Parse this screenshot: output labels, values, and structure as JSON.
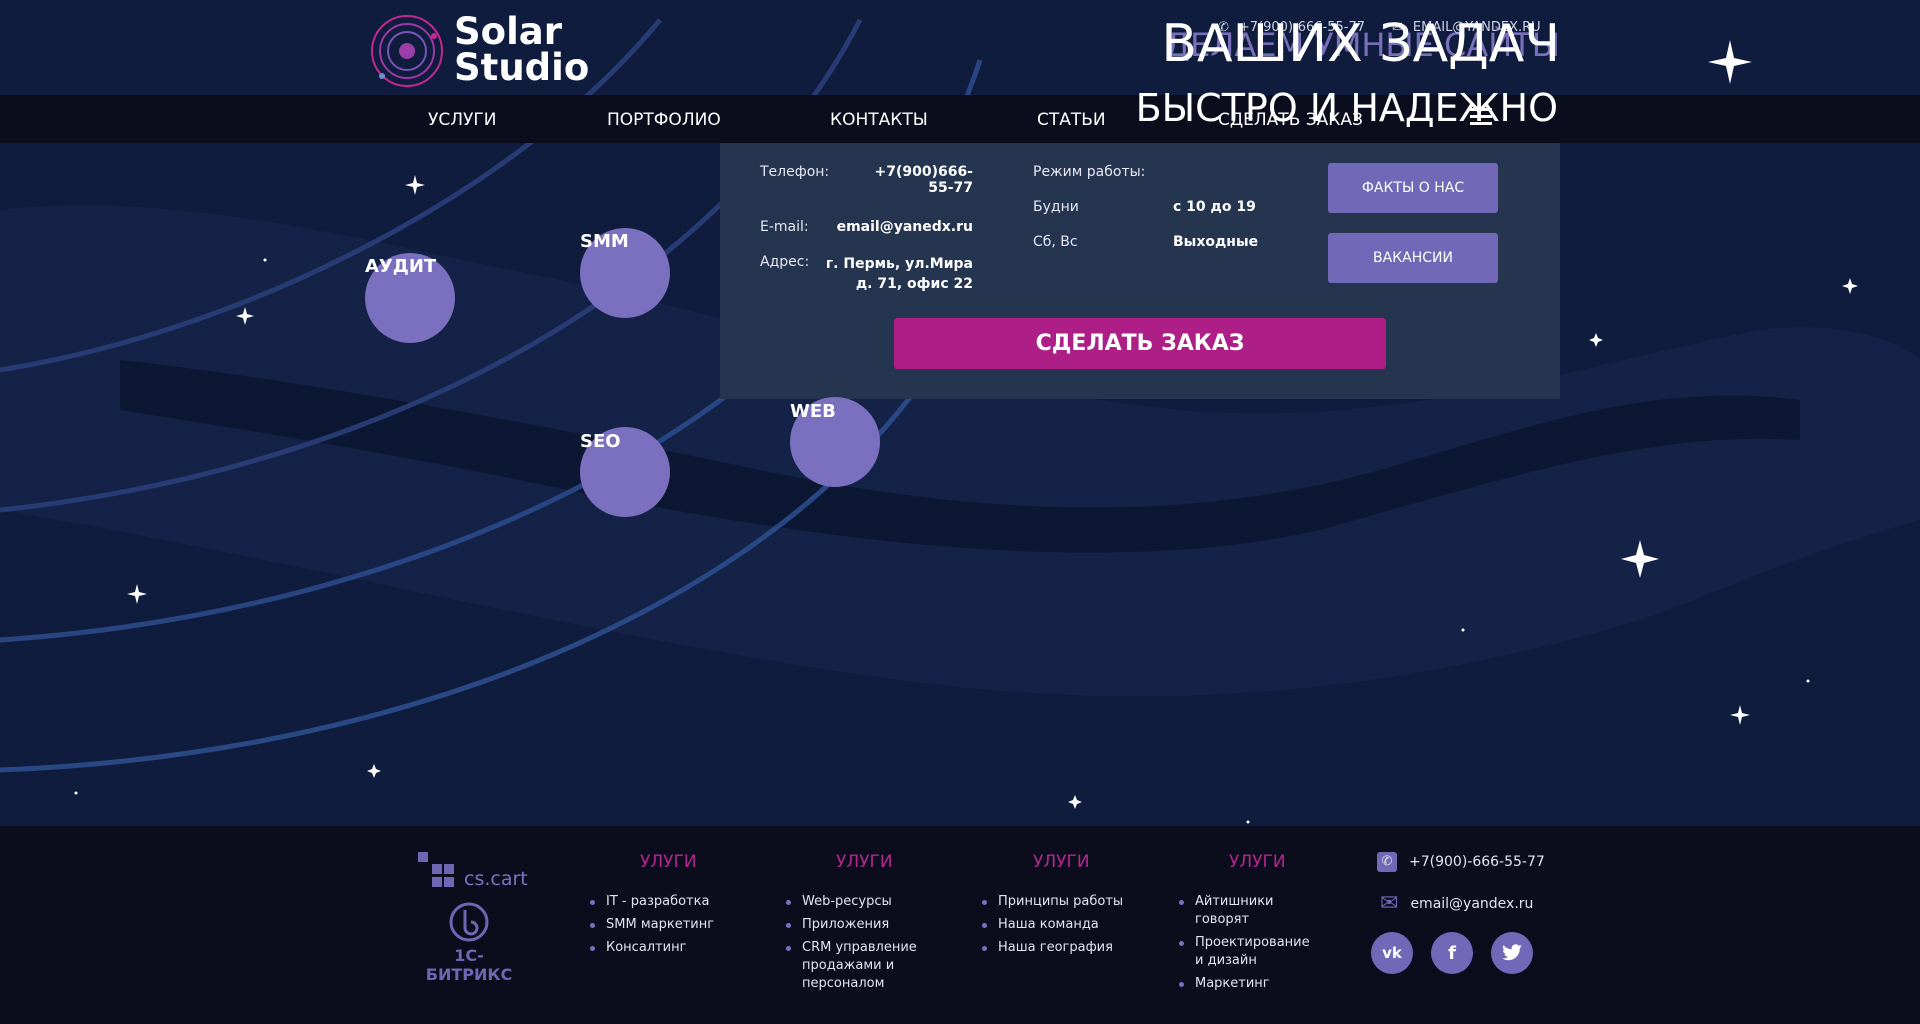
{
  "brand": {
    "name_line1": "Solar",
    "name_line2": "Studio"
  },
  "header": {
    "phone": "+7(900)-666-55-77",
    "email": "EMAIL@YANDEX.RU",
    "hero_title": "ВАШИХ ЗАДАЧ",
    "hero_title_ghost": "ДЕЛАЕМ УМНЫЕ САЙТЫ",
    "hero_subtitle": "БЫСТРО И НАДЕЖНО"
  },
  "nav": {
    "items": [
      "УСЛУГИ",
      "ПОРТФОЛИО",
      "КОНТАКТЫ",
      "СТАТЬИ",
      "СДЕЛАТЬ ЗАКАЗ"
    ]
  },
  "panel": {
    "phone_label": "Телефон:",
    "phone_value": "+7(900)666-55-77",
    "email_label": "E-mail:",
    "email_value": "email@yanedx.ru",
    "address_label": "Адрес:",
    "address_value": "г. Пермь, ул.Мира д. 71, офис 22",
    "hours_label": "Режим работы:",
    "weekdays_label": "Будни",
    "weekdays_value": "с 10 до 19",
    "weekend_label": "Сб, Вс",
    "weekend_value": "Выходные",
    "facts_button": "ФАКТЫ О НАС",
    "vacancies_button": "ВАКАНСИИ",
    "order_button": "СДЕЛАТЬ ЗАКАЗ"
  },
  "planets": {
    "audit": "АУДИТ",
    "smm": "SMM",
    "seo": "SEO",
    "web": "WEB"
  },
  "footer": {
    "logos": {
      "cscart": "cs.cart",
      "bitrix": "1С-БИТРИКС"
    },
    "columns": [
      {
        "title": "УЛУГИ",
        "items": [
          "IT - разработка",
          "SMM маркетинг",
          "Консалтинг"
        ]
      },
      {
        "title": "УЛУГИ",
        "items": [
          "Web-ресурсы",
          "Приложения",
          "CRM управление продажами и персоналом"
        ]
      },
      {
        "title": "УЛУГИ",
        "items": [
          "Принципы работы",
          "Наша команда",
          "Наша география"
        ]
      },
      {
        "title": "УЛУГИ",
        "items": [
          "Айтишники говорят",
          "Проектирование и дизайн",
          "Маркетинг"
        ]
      }
    ],
    "phone": "+7(900)-666-55-77",
    "email": "email@yandex.ru",
    "social": {
      "vk": "vk",
      "facebook": "f",
      "twitter": "twitter"
    }
  },
  "colors": {
    "accent": "#7169b8",
    "order": "#ad1f86",
    "panel": "#253550",
    "nav": "#0b0d1c"
  }
}
